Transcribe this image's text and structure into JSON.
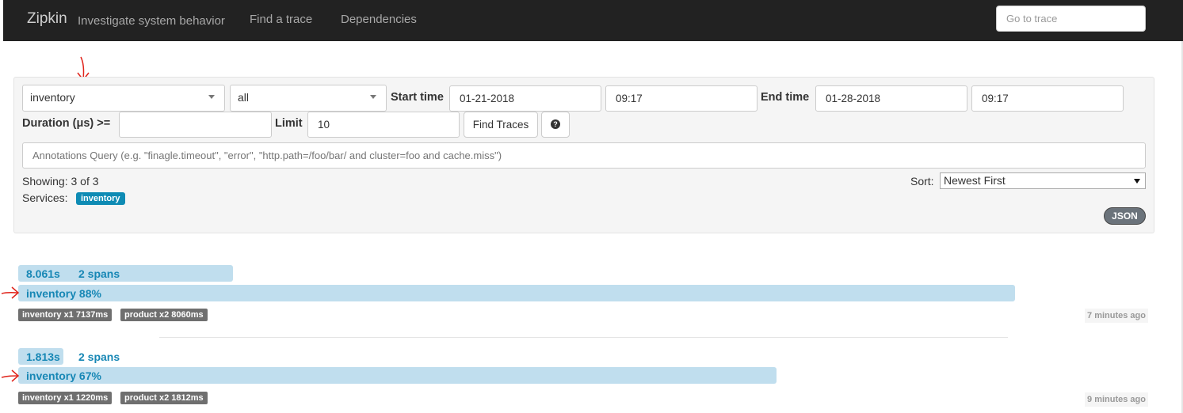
{
  "navbar": {
    "brand": "Zipkin",
    "tagline": "Investigate system behavior",
    "links": [
      "Find a trace",
      "Dependencies"
    ],
    "goto_placeholder": "Go to trace"
  },
  "search": {
    "service_value": "inventory",
    "span_value": "all",
    "start_time_label": "Start time",
    "start_date": "01-21-2018",
    "start_time": "09:17",
    "end_time_label": "End time",
    "end_date": "01-28-2018",
    "end_time": "09:17",
    "duration_label": "Duration (μs) >=",
    "duration_value": "",
    "limit_label": "Limit",
    "limit_value": "10",
    "find_button": "Find Traces",
    "help_icon_glyph": "?",
    "annotations_placeholder": "Annotations Query (e.g. \"finagle.timeout\", \"error\", \"http.path=/foo/bar/ and cluster=foo and cache.miss\")"
  },
  "results": {
    "showing": "Showing: 3 of 3",
    "services_label": "Services:",
    "services": [
      "inventory"
    ],
    "sort_label": "Sort:",
    "sort_value": "Newest First",
    "json_button": "JSON"
  },
  "traces": [
    {
      "duration": "8.061s",
      "spans": "2 spans",
      "service_line": "inventory 88%",
      "percent": 88,
      "tags": [
        "inventory x1 7137ms",
        "product x2 8060ms"
      ],
      "ago": "7 minutes ago"
    },
    {
      "duration": "1.813s",
      "spans": "2 spans",
      "service_line": "inventory 67%",
      "percent": 67,
      "tags": [
        "inventory x1 1220ms",
        "product x2 1812ms"
      ],
      "ago": "9 minutes ago"
    }
  ],
  "colors": {
    "navbar": "#222222",
    "bar": "#c0deee",
    "bar_text": "#1787b5",
    "badge": "#0e8bb4",
    "annotation_arrow": "#e0241b"
  }
}
